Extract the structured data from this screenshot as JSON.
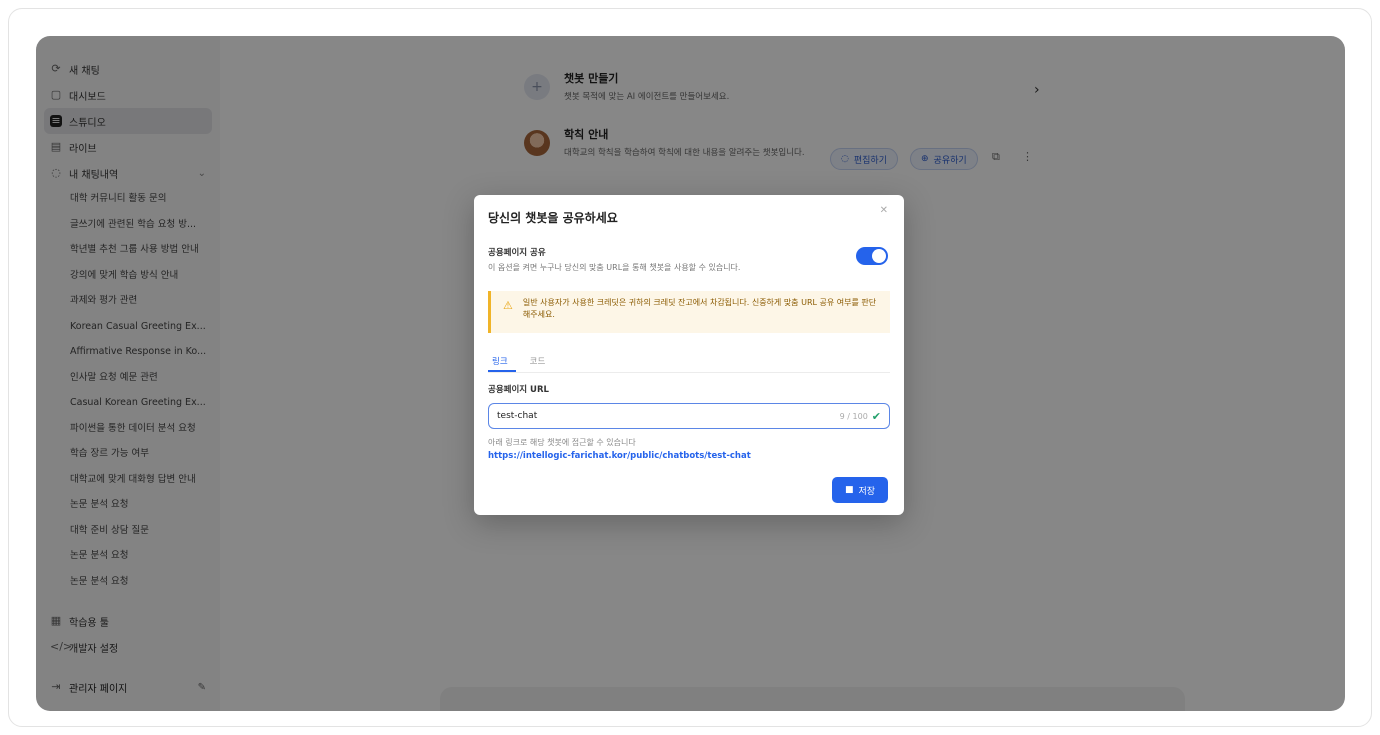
{
  "sidebar": {
    "top_items": [
      {
        "icon": "refresh-icon",
        "label": "새 채팅"
      },
      {
        "icon": "dashboard-icon",
        "label": "대시보드"
      },
      {
        "icon": "chatbot-icon",
        "label": "스튜디오"
      },
      {
        "icon": "library-icon",
        "label": "라이브"
      },
      {
        "icon": "chat-icon",
        "label": "내 채팅내역"
      }
    ],
    "history": [
      "대학 커뮤니티 활동 문의",
      "글쓰기에 관련된 학습 요청 방...",
      "학년별 추천 그룹 사용 방법 안내",
      "강의에 맞게 학습 방식 안내",
      "과제와 평가 관련",
      "Korean Casual Greeting Ex...",
      "Affirmative Response in Ko...",
      "인사말 요청 예문 관련",
      "Casual Korean Greeting Ex...",
      "파이썬을 통한 데이터 분석 요청",
      "학습 장르 가능 여부",
      "대학교에 맞게 대화형 답변 안내",
      "논문 분석 요청",
      "대학 준비 상담 질문",
      "논문 분석 요청",
      "논문 분석 요청"
    ],
    "bottom_items": [
      {
        "icon": "grid-icon",
        "label": "학습용 툴"
      },
      {
        "icon": "code-icon",
        "label": "개발자 설정"
      }
    ],
    "admin": {
      "label": "관리자 페이지"
    }
  },
  "main": {
    "bots": [
      {
        "title": "챗봇 만들기",
        "desc": "챗봇 목적에 맞는 AI 에이전트를 만들어보세요."
      },
      {
        "title": "학칙 안내",
        "desc": "대학교의 학칙을 학습하여 학칙에 대한 내용을 알려주는 챗봇입니다."
      }
    ],
    "pill_edit": "편집하기",
    "pill_share": "공유하기"
  },
  "modal": {
    "title": "당신의 챗봇을 공유하세요",
    "public_label": "공용페이지 공유",
    "public_sub": "이 옵션을 켜면 누구나 당신의 맞춤 URL을 통해 챗봇을 사용할 수 있습니다.",
    "toggle_on": true,
    "warning": "일반 사용자가 사용한 크레딧은 귀하의 크레딧 잔고에서 차감됩니다. 신중하게 맞춤 URL 공유 여부를 판단해주세요.",
    "tabs": [
      "링크",
      "코드"
    ],
    "active_tab": 0,
    "url_label": "공용페이지 URL",
    "url_value": "test-chat",
    "url_count": "9 / 100",
    "help_text": "아래 링크로 해당 챗봇에 접근할 수 있습니다",
    "link": "https://intellogic-farichat.kor/public/chatbots/test-chat",
    "save_label": "저장"
  },
  "colors": {
    "accent": "#2563eb",
    "warning": "#f0b429",
    "success": "#22a06b"
  }
}
